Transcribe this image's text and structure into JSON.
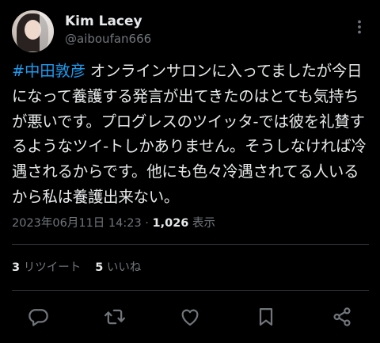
{
  "author": {
    "display_name": "Kim Lacey",
    "handle": "@aiboufan666",
    "avatar_icon": "user-avatar"
  },
  "tweet": {
    "hashtag": "#中田敦彦",
    "text": " オンラインサロンに入ってましたが今日になって養護する発言が出てきたのはとても気持ちが悪いです。プログレスのツイッタ-では彼を礼賛するようなツイ-トしかありません。そうしなければ冷遇されるからです。他にも色々冷遇されてる人いるから私は養護出来ない。"
  },
  "meta": {
    "timestamp": "2023年06月11日 14:23",
    "separator": " · ",
    "views_count": "1,026",
    "views_label": " 表示"
  },
  "stats": {
    "retweets_count": "3",
    "retweets_label": " リツイート",
    "likes_count": "5",
    "likes_label": " いいね"
  },
  "actions": {
    "reply_icon": "reply-icon",
    "retweet_icon": "retweet-icon",
    "like_icon": "heart-icon",
    "bookmark_icon": "bookmark-icon",
    "share_icon": "share-icon"
  },
  "colors": {
    "background": "#000000",
    "text_primary": "#e7e9ea",
    "text_secondary": "#71767b",
    "link": "#1d9bf0",
    "divider": "#2f3336"
  }
}
